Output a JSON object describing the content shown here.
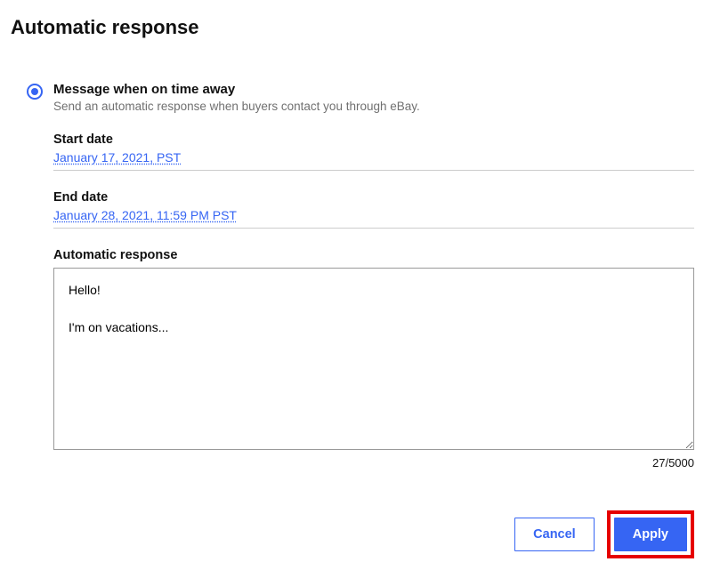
{
  "page": {
    "title": "Automatic response"
  },
  "option": {
    "title": "Message when on time away",
    "description": "Send an automatic response when buyers contact you through eBay."
  },
  "start_date": {
    "label": "Start date",
    "value": "January 17, 2021, PST"
  },
  "end_date": {
    "label": "End date",
    "value": "January 28, 2021, 11:59 PM PST"
  },
  "response": {
    "label": "Automatic response",
    "value": "Hello!\n\nI'm on vacations...",
    "char_count": "27/5000"
  },
  "actions": {
    "cancel": "Cancel",
    "apply": "Apply"
  }
}
